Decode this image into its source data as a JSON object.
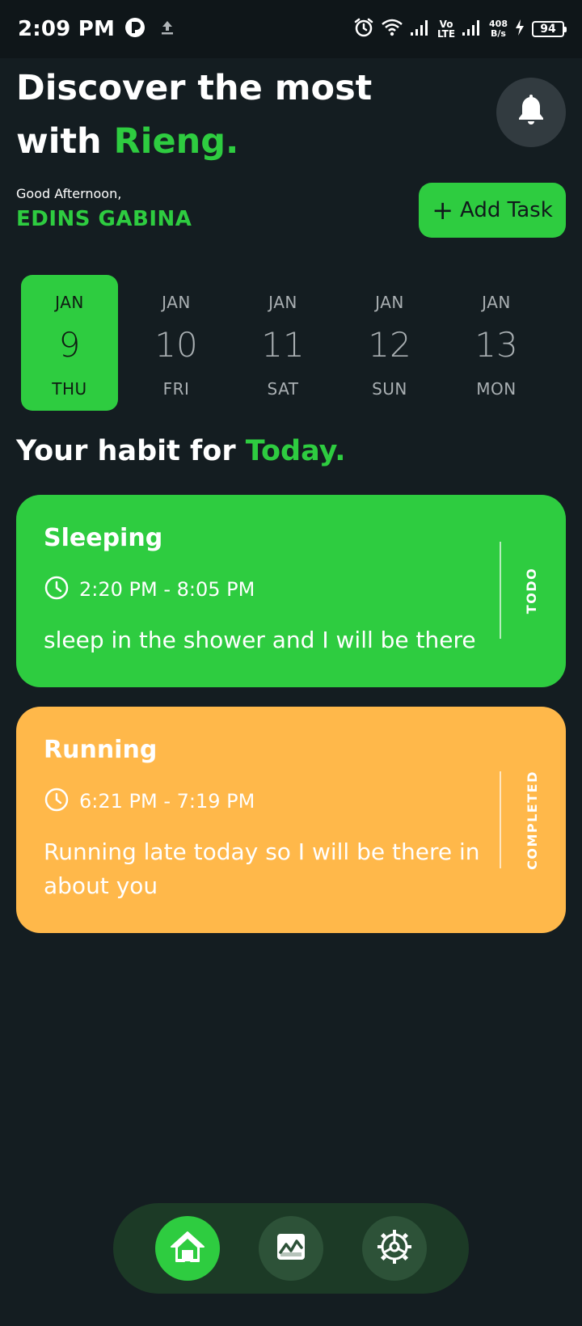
{
  "status_bar": {
    "time": "2:09 PM",
    "net_speed_value": "408",
    "net_speed_unit": "B/s",
    "volte_top": "Vo",
    "volte_bottom": "LTE",
    "battery": "94"
  },
  "header": {
    "headline_part1": "Discover the most",
    "headline_part2": "with ",
    "headline_brand": "Rieng."
  },
  "user": {
    "greeting": "Good Afternoon,",
    "name": "EDINS GABINA"
  },
  "add_task_label": "Add Task",
  "dates": [
    {
      "month": "JAN",
      "day": "9",
      "dow": "THU",
      "selected": true
    },
    {
      "month": "JAN",
      "day": "10",
      "dow": "FRI",
      "selected": false
    },
    {
      "month": "JAN",
      "day": "11",
      "dow": "SAT",
      "selected": false
    },
    {
      "month": "JAN",
      "day": "12",
      "dow": "SUN",
      "selected": false
    },
    {
      "month": "JAN",
      "day": "13",
      "dow": "MON",
      "selected": false
    }
  ],
  "section": {
    "title_prefix": "Your habit for ",
    "title_accent": "Today."
  },
  "habits": [
    {
      "title": "Sleeping",
      "time": "2:20 PM - 8:05 PM",
      "description": "sleep in the shower and I will be there",
      "status": "TODO",
      "color": "#2ecc40"
    },
    {
      "title": "Running",
      "time": "6:21 PM - 7:19 PM",
      "description": "Running late today so I will be there in about you",
      "status": "COMPLETED",
      "color": "#ffb84a"
    }
  ],
  "nav": {
    "items": [
      "home-icon",
      "chart-icon",
      "settings-icon"
    ],
    "active": "home-icon"
  },
  "colors": {
    "background": "#141d21",
    "accent": "#2ecc40",
    "orange": "#ffb84a"
  }
}
